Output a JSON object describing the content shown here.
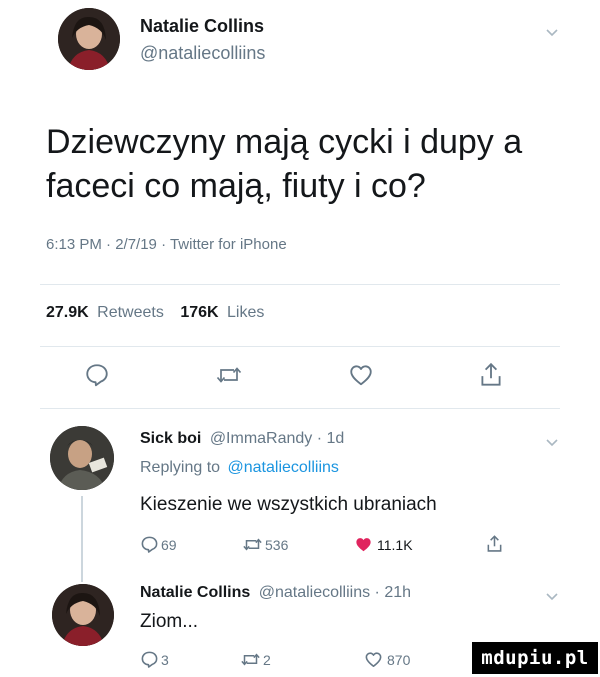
{
  "tweet": {
    "author_name": "Natalie Collins",
    "author_handle": "@nataliecolliins",
    "text_line1": "Dziewczyny mają cycki i dupy a",
    "text_line2": "faceci co mają, fiuty i co?",
    "meta": "6:13 PM · 2/7/19 · Twitter for iPhone",
    "retweets_count": "27.9K",
    "retweets_label": "Retweets",
    "likes_count": "176K",
    "likes_label": "Likes"
  },
  "replies": [
    {
      "name": "Sick boi",
      "handle_time": "@ImmaRandy · 1d",
      "replying_prefix": "Replying to",
      "replying_handle": "@nataliecolliins",
      "text": "Kieszenie we wszystkich ubraniach",
      "reply_count": "69",
      "retweet_count": "536",
      "like_count": "11.1K"
    },
    {
      "name": "Natalie Collins",
      "handle_time": "@nataliecolliins · 21h",
      "text": "Ziom...",
      "reply_count": "3",
      "retweet_count": "2",
      "like_count": "870"
    }
  ],
  "watermark": "mdupiu.pl",
  "colors": {
    "like_red": "#e0245e",
    "link_blue": "#1b95e0",
    "muted": "#657786"
  }
}
